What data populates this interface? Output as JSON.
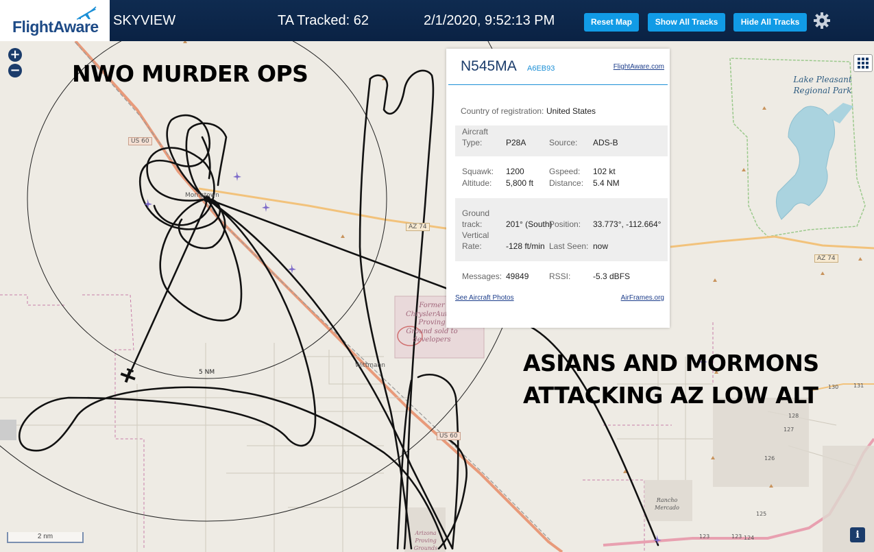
{
  "header": {
    "logo_text": "FlightAware",
    "app_name": "SKYVIEW",
    "tracked": "TA Tracked: 62",
    "datetime": "2/1/2020, 9:52:13 PM",
    "buttons": {
      "reset": "Reset Map",
      "show": "Show All Tracks",
      "hide": "Hide All Tracks"
    }
  },
  "map": {
    "zoom_in": "+",
    "zoom_out": "−",
    "scale_label": "2 nm",
    "ring_label": "5 NM",
    "road_labels": {
      "us60_top": "US 60",
      "az74_mid": "AZ 74",
      "az74_right": "AZ 74",
      "us60_bottom": "US 60"
    },
    "place_labels": {
      "morristown": "Morristown",
      "wittmann": "Wittmann",
      "lake": "Lake Pleasant Regional Park",
      "former": "Former ChryslerAutomotive Proving Ground sold to developers",
      "rancho": "Rancho Mercado",
      "arizona_pg": "Arizona Proving Grounds"
    },
    "route_numbers": [
      "130",
      "131",
      "128",
      "127",
      "126",
      "125",
      "124",
      "123",
      "123"
    ],
    "overlay_text_1": "NWO MURDER OPS",
    "overlay_text_2a": "ASIANS AND MORMONS",
    "overlay_text_2b": "ATTACKING AZ LOW ALT",
    "info_button": "i"
  },
  "popup": {
    "registration": "N545MA",
    "hex": "A6EB93",
    "fa_link": "FlightAware.com",
    "country_label": "Country of registration:",
    "country_value": "United States",
    "aircraft_label_1": "Aircraft",
    "type_label": "Type:",
    "type_value": "P28A",
    "source_label": "Source:",
    "source_value": "ADS-B",
    "squawk_label": "Squawk:",
    "squawk_value": "1200",
    "gspeed_label": "Gspeed:",
    "gspeed_value": "102 kt",
    "altitude_label": "Altitude:",
    "altitude_value": "5,800 ft",
    "distance_label": "Distance:",
    "distance_value": "5.4 NM",
    "ground_label": "Ground",
    "track_label": "track:",
    "track_value": "201° (South)",
    "position_label": "Position:",
    "position_value": "33.773°, -112.664°",
    "vertical_label": "Vertical",
    "rate_label": "Rate:",
    "rate_value": "-128 ft/min",
    "last_seen_label": "Last Seen:",
    "last_seen_value": "now",
    "messages_label": "Messages:",
    "messages_value": "49849",
    "rssi_label": "RSSI:",
    "rssi_value": "-5.3 dBFS",
    "photos_link": "See Aircraft Photos",
    "airframes_link": "AirFrames.org"
  },
  "colors": {
    "header_bg": "#0a2244",
    "button": "#119be6",
    "road_us60": "#e89a7a",
    "road_az74": "#f2c27b",
    "water": "#aad3df",
    "boundary": "#c87ca8"
  }
}
